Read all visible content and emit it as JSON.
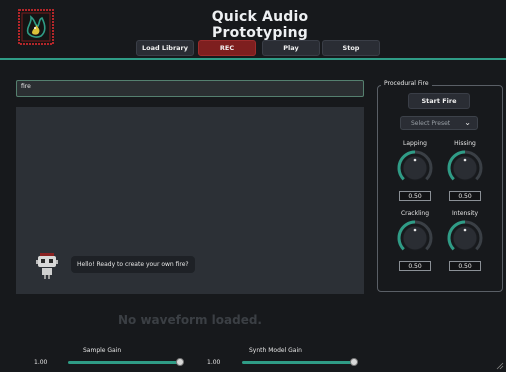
{
  "header": {
    "title": "Quick Audio Prototyping",
    "logo_icon": "flame-logo-icon",
    "buttons": {
      "load_library": "Load Library",
      "rec": "REC",
      "play": "Play",
      "stop": "Stop"
    }
  },
  "search": {
    "value": "fire"
  },
  "chat": {
    "avatar_icon": "robot-avatar-icon",
    "message": "Hello! Ready to create your own fire?"
  },
  "waveform": {
    "empty_text": "No waveform loaded."
  },
  "sliders": {
    "sample_gain": {
      "label": "Sample Gain",
      "value": "1.00",
      "level": 1.0
    },
    "synth_gain": {
      "label": "Synth Model Gain",
      "value": "1.00",
      "level": 1.0
    }
  },
  "panel": {
    "title": "Procedural Fire",
    "start_label": "Start Fire",
    "preset_label": "Select Preset",
    "knobs": [
      {
        "label": "Lapping",
        "value": "0.50",
        "level": 0.5
      },
      {
        "label": "Hissing",
        "value": "0.50",
        "level": 0.5
      },
      {
        "label": "Crackling",
        "value": "0.50",
        "level": 0.5
      },
      {
        "label": "Intensity",
        "value": "0.50",
        "level": 0.5
      }
    ]
  },
  "colors": {
    "accent": "#2f9c86",
    "rec": "#7e1f1f",
    "background": "#17191c",
    "chat_area": "#2c3036"
  }
}
